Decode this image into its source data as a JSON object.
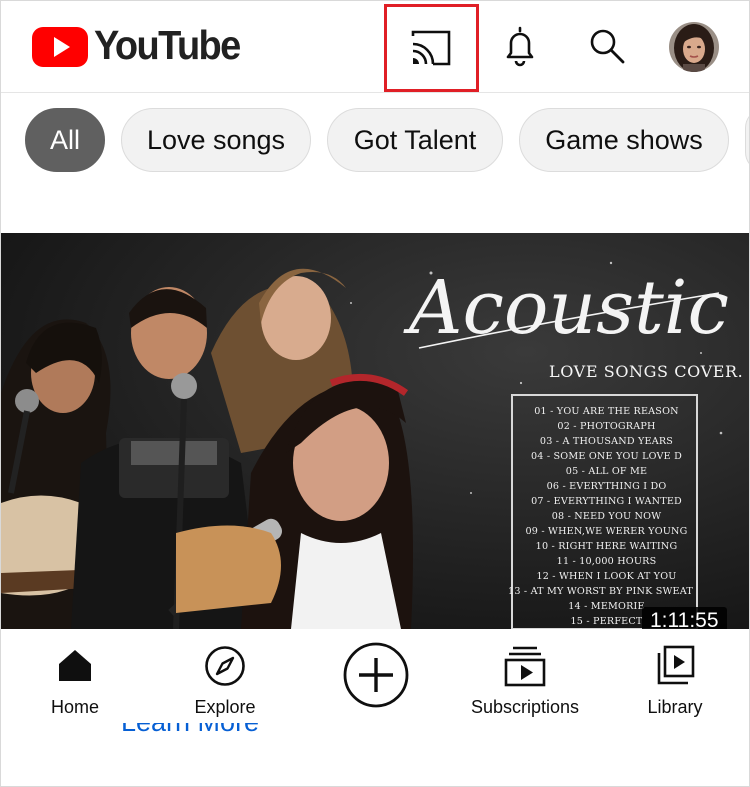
{
  "header": {
    "logo_text": "YouTube",
    "brand_color": "#ff0000",
    "icons": [
      "cast-icon",
      "bell-icon",
      "search-icon",
      "avatar"
    ],
    "highlight_color": "#e01f26"
  },
  "chips": [
    {
      "label": "All",
      "active": true
    },
    {
      "label": "Love songs",
      "active": false
    },
    {
      "label": "Got Talent",
      "active": false
    },
    {
      "label": "Game shows",
      "active": false
    }
  ],
  "video": {
    "title_art": "Acoustic",
    "subtitle": "LOVE SONGS COVER.",
    "tracks": [
      "01 - YOU ARE THE REASON",
      "02 - PHOTOGRAPH",
      "03 - A THOUSAND YEARS",
      "04 - SOME ONE YOU LOVE D",
      "05 - ALL OF ME",
      "06 - EVERYTHING I DO",
      "07 - EVERYTHING I WANTED",
      "08 - NEED YOU NOW",
      "09 - WHEN,WE WERER YOUNG",
      "10 - RIGHT HERE WAITING",
      "11 - 10,000 HOURS",
      "12 - WHEN I LOOK AT YOU",
      "13 - AT MY WORST BY PINK SWEAT",
      "14 - MEMORIE",
      "15 - PERFECT"
    ],
    "duration": "1:11:55"
  },
  "learn_more": "Learn More",
  "bottom_nav": {
    "home": "Home",
    "explore": "Explore",
    "create": "create",
    "subscriptions": "Subscriptions",
    "library": "Library"
  }
}
